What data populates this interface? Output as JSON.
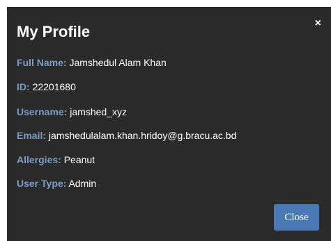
{
  "modal": {
    "title": "My Profile",
    "close_symbol": "×",
    "close_button_label": "Close",
    "fields": [
      {
        "label": "Full Name:",
        "value": "Jamshedul Alam Khan"
      },
      {
        "label": "ID:",
        "value": "22201680"
      },
      {
        "label": "Username:",
        "value": "jamshed_xyz"
      },
      {
        "label": "Email:",
        "value": "jamshedulalam.khan.hridoy@g.bracu.ac.bd"
      },
      {
        "label": "Allergies:",
        "value": "Peanut"
      },
      {
        "label": "User Type:",
        "value": "Admin"
      }
    ]
  },
  "colors": {
    "modal_background": "#2b2b2b",
    "label": "#7a9cc6",
    "value": "#ffffff",
    "button": "#4a7ab5"
  },
  "icons": {
    "close": "close-icon"
  }
}
